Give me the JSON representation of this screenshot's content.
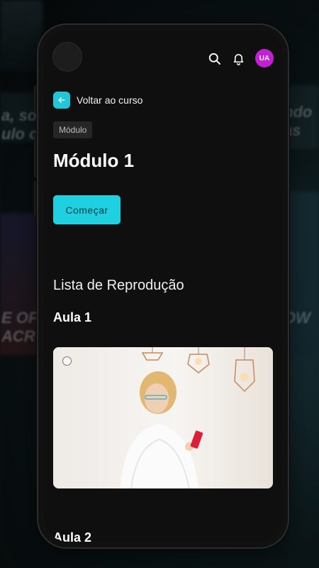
{
  "header": {
    "avatar_initials": "UA",
    "avatar_color": "#c21fd6"
  },
  "nav": {
    "back_label": "Voltar ao curso"
  },
  "module": {
    "chip": "Módulo",
    "title": "Módulo 1",
    "start_button": "Começar"
  },
  "playlist": {
    "title": "Lista de Reprodução",
    "lessons": [
      {
        "title": "Aula 1"
      },
      {
        "title": "Aula 2"
      }
    ]
  },
  "colors": {
    "accent": "#1ed0e0",
    "background": "#0f0f0f"
  },
  "icons": [
    "search-icon",
    "bell-icon",
    "arrow-left-icon",
    "check-circle-icon"
  ]
}
